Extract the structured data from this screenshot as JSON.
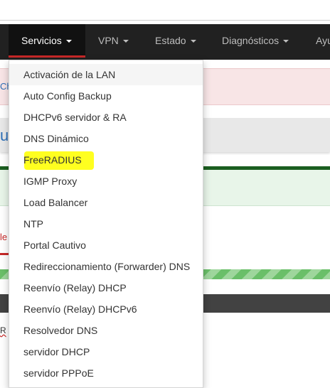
{
  "nav": {
    "items": [
      {
        "label": "Servicios"
      },
      {
        "label": "VPN"
      },
      {
        "label": "Estado"
      },
      {
        "label": "Diagnósticos"
      },
      {
        "label": "Ayu"
      }
    ]
  },
  "background": {
    "alert_text": "Ch",
    "panel_text": "u",
    "tab_text": "le",
    "small_text": "R"
  },
  "dropdown": {
    "items": [
      {
        "label": "Activación de la LAN"
      },
      {
        "label": "Auto Config Backup"
      },
      {
        "label": "DHCPv6 servidor & RA"
      },
      {
        "label": "DNS Dinámico"
      },
      {
        "label": "FreeRADIUS"
      },
      {
        "label": "IGMP Proxy"
      },
      {
        "label": "Load Balancer"
      },
      {
        "label": "NTP"
      },
      {
        "label": "Portal Cautivo"
      },
      {
        "label": "Redireccionamiento (Forwarder) DNS"
      },
      {
        "label": "Reenvío (Relay) DHCP"
      },
      {
        "label": "Reenvío (Relay) DHCPv6"
      },
      {
        "label": "Resolvedor DNS"
      },
      {
        "label": "servidor DHCP"
      },
      {
        "label": "servidor PPPoE"
      }
    ]
  },
  "colors": {
    "navbar": "#212121",
    "active_underline": "#c62828",
    "highlight": "#ffff20"
  }
}
